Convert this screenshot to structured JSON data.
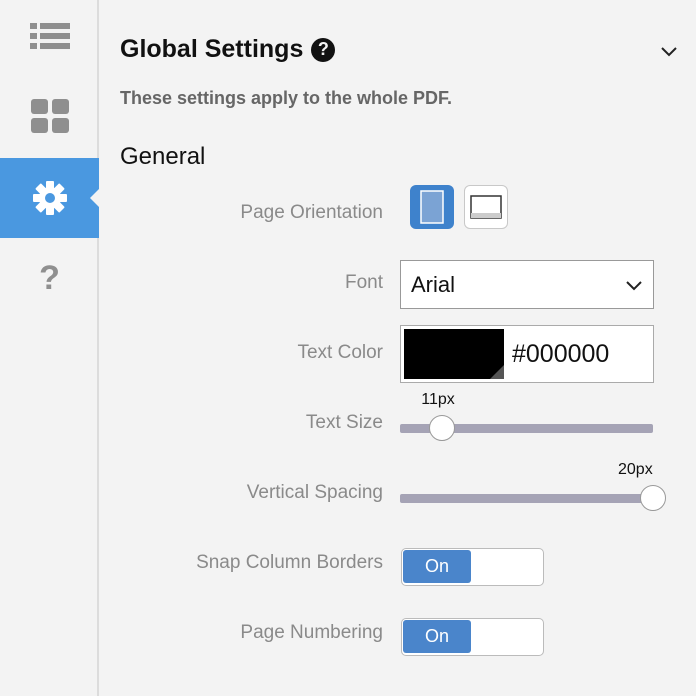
{
  "sidebar": {
    "items": [
      {
        "icon": "list-icon"
      },
      {
        "icon": "grid-icon"
      },
      {
        "icon": "gear-icon",
        "active": true
      },
      {
        "icon": "question-icon"
      }
    ]
  },
  "header": {
    "title": "Global Settings",
    "help_icon": "?",
    "subtitle": "These settings apply to the whole PDF."
  },
  "section": {
    "title": "General"
  },
  "settings": {
    "page_orientation": {
      "label": "Page Orientation",
      "selected": "portrait"
    },
    "font": {
      "label": "Font",
      "value": "Arial"
    },
    "text_color": {
      "label": "Text Color",
      "value": "#000000",
      "swatch": "#000000"
    },
    "text_size": {
      "label": "Text Size",
      "value": "11px",
      "fraction": 0.14
    },
    "vertical_spacing": {
      "label": "Vertical Spacing",
      "value": "20px",
      "fraction": 1.0
    },
    "snap_column_borders": {
      "label": "Snap Column Borders",
      "state": "On"
    },
    "page_numbering": {
      "label": "Page Numbering",
      "state": "On"
    }
  },
  "colors": {
    "accent": "#4a98e0",
    "toggle_on": "#4a85cb",
    "track": "#a5a3b5"
  }
}
